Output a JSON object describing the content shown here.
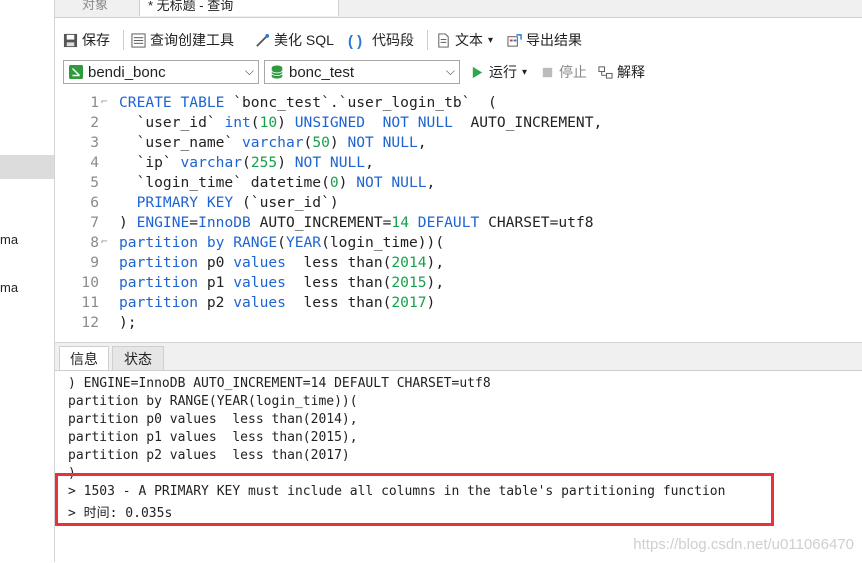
{
  "sidebar": {
    "items": [
      "ma",
      "ma"
    ]
  },
  "tabs": {
    "objects": "对象",
    "query": "* 无标题 - 查询"
  },
  "toolbar": {
    "save": "保存",
    "query_builder": "查询创建工具",
    "beautify_sql": "美化 SQL",
    "code_snippet": "代码段",
    "text": "文本",
    "export_result": "导出结果"
  },
  "toolbar2": {
    "connection": "bendi_bonc",
    "database": "bonc_test",
    "run": "运行",
    "stop": "停止",
    "explain": "解释"
  },
  "editor": {
    "line_numbers": [
      "1",
      "2",
      "3",
      "4",
      "5",
      "6",
      "7",
      "8",
      "9",
      "10",
      "11",
      "12"
    ],
    "lines": [
      [
        [
          "k",
          "CREATE TABLE"
        ],
        [
          "t",
          " `bonc_test`.`user_login_tb`  ("
        ]
      ],
      [
        [
          "t",
          "  `user_id` "
        ],
        [
          "k",
          "int"
        ],
        [
          "t",
          "("
        ],
        [
          "n",
          "10"
        ],
        [
          "t",
          ") "
        ],
        [
          "k",
          "UNSIGNED  NOT NULL"
        ],
        [
          "t",
          "  AUTO_INCREMENT,"
        ]
      ],
      [
        [
          "t",
          "  `user_name` "
        ],
        [
          "k",
          "varchar"
        ],
        [
          "t",
          "("
        ],
        [
          "n",
          "50"
        ],
        [
          "t",
          ") "
        ],
        [
          "k",
          "NOT NULL"
        ],
        [
          "t",
          ","
        ]
      ],
      [
        [
          "t",
          "  `ip` "
        ],
        [
          "k",
          "varchar"
        ],
        [
          "t",
          "("
        ],
        [
          "n",
          "255"
        ],
        [
          "t",
          ") "
        ],
        [
          "k",
          "NOT NULL"
        ],
        [
          "t",
          ","
        ]
      ],
      [
        [
          "t",
          "  `login_time` datetime("
        ],
        [
          "n",
          "0"
        ],
        [
          "t",
          ") "
        ],
        [
          "k",
          "NOT NULL"
        ],
        [
          "t",
          ","
        ]
      ],
      [
        [
          "k",
          "  PRIMARY KEY"
        ],
        [
          "t",
          " (`user_id`)"
        ]
      ],
      [
        [
          "t",
          ") "
        ],
        [
          "k",
          "ENGINE"
        ],
        [
          "t",
          "="
        ],
        [
          "k",
          "InnoDB"
        ],
        [
          "t",
          " AUTO_INCREMENT="
        ],
        [
          "n",
          "14"
        ],
        [
          "t",
          " "
        ],
        [
          "k",
          "DEFAULT"
        ],
        [
          "t",
          " CHARSET=utf8"
        ]
      ],
      [
        [
          "k",
          "partition by RANGE"
        ],
        [
          "t",
          "("
        ],
        [
          "k",
          "YEAR"
        ],
        [
          "t",
          "(login_time))("
        ]
      ],
      [
        [
          "k",
          "partition"
        ],
        [
          "t",
          " p0 "
        ],
        [
          "k",
          "values"
        ],
        [
          "t",
          "  less than("
        ],
        [
          "n",
          "2014"
        ],
        [
          "t",
          "),"
        ]
      ],
      [
        [
          "k",
          "partition"
        ],
        [
          "t",
          " p1 "
        ],
        [
          "k",
          "values"
        ],
        [
          "t",
          "  less than("
        ],
        [
          "n",
          "2015"
        ],
        [
          "t",
          "),"
        ]
      ],
      [
        [
          "k",
          "partition"
        ],
        [
          "t",
          " p2 "
        ],
        [
          "k",
          "values"
        ],
        [
          "t",
          "  less than("
        ],
        [
          "n",
          "2017"
        ],
        [
          "t",
          ")"
        ]
      ],
      [
        [
          "t",
          ");"
        ]
      ]
    ]
  },
  "output_tabs": {
    "info": "信息",
    "status": "状态"
  },
  "output": {
    "lines": [
      ") ENGINE=InnoDB AUTO_INCREMENT=14 DEFAULT CHARSET=utf8",
      "partition by RANGE(YEAR(login_time))(",
      "partition p0 values  less than(2014),",
      "partition p1 values  less than(2015),",
      "partition p2 values  less than(2017)",
      ")",
      "> 1503 - A PRIMARY KEY must include all columns in the table's partitioning function",
      "> 时间: 0.035s"
    ]
  },
  "watermark": "https://blog.csdn.net/u011066470",
  "colors": {
    "keyword": "#1e64d2",
    "number": "#16a04a",
    "highlight_box": "#e8323a"
  }
}
